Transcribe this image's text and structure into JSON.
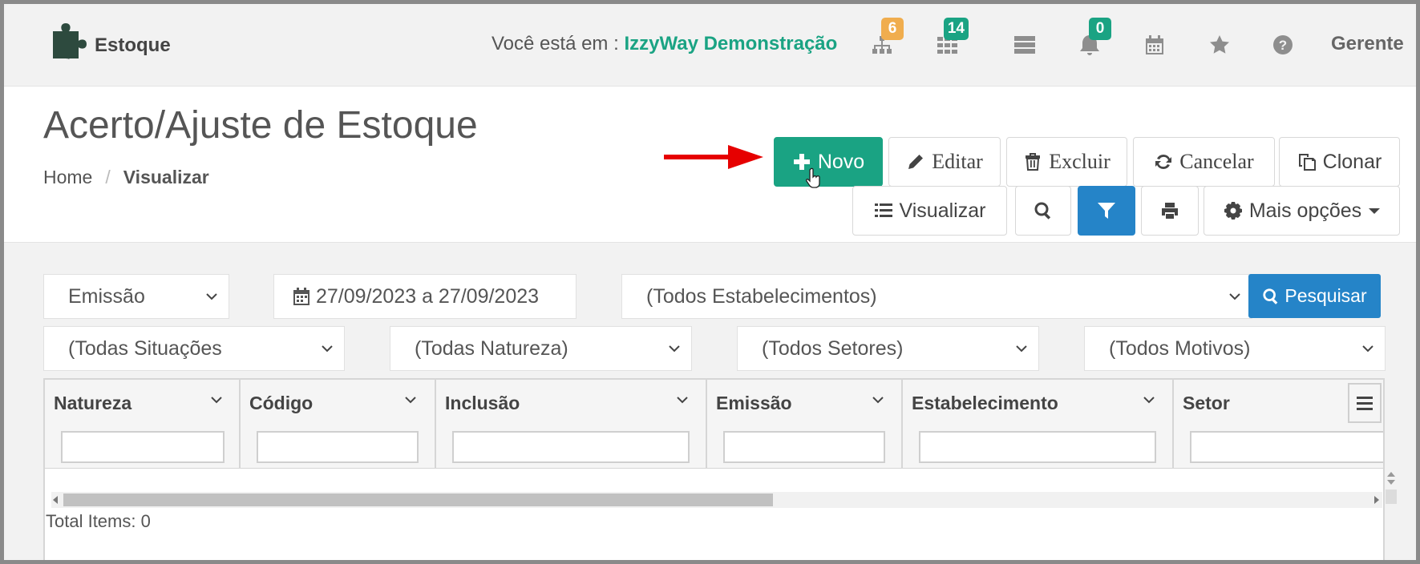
{
  "navbar": {
    "brand": "Estoque",
    "location_label": "Você está em :",
    "company": "IzzyWay Demonstração",
    "icons": [
      {
        "name": "sitemap-icon",
        "badge": "6",
        "badge_color": "#f0ad4e"
      },
      {
        "name": "grid-icon",
        "badge": "14",
        "badge_color": "#1aa383"
      },
      {
        "name": "server-icon",
        "badge": ""
      },
      {
        "name": "bell-icon",
        "badge": "0",
        "badge_color": "#1aa383"
      },
      {
        "name": "calendar-icon",
        "badge": ""
      },
      {
        "name": "star-icon",
        "badge": ""
      },
      {
        "name": "help-icon",
        "badge": ""
      }
    ],
    "user": "Gerente"
  },
  "header": {
    "title": "Acerto/Ajuste de Estoque",
    "breadcrumb": {
      "home": "Home",
      "separator": "/",
      "current": "Visualizar"
    }
  },
  "toolbar": {
    "novo": "Novo",
    "editar": "Editar",
    "excluir": "Excluir",
    "cancelar": "Cancelar",
    "clonar": "Clonar",
    "visualizar": "Visualizar",
    "mais_opcoes": "Mais opções"
  },
  "filters": {
    "date_type": "Emissão",
    "date_range": "27/09/2023 a 27/09/2023",
    "estabelecimentos": "(Todos Estabelecimentos)",
    "search_button": "Pesquisar",
    "situacoes": "(Todas Situações",
    "natureza": "(Todas Natureza)",
    "setores": "(Todos Setores)",
    "motivos": "(Todos Motivos)"
  },
  "grid": {
    "columns": [
      "Natureza",
      "Código",
      "Inclusão",
      "Emissão",
      "Estabelecimento",
      "Setor"
    ],
    "total_label": "Total Items: 0"
  },
  "colors": {
    "accent_green": "#1aa383",
    "accent_blue": "#2584c8",
    "badge_orange": "#f0ad4e",
    "arrow_red": "#e60000"
  }
}
